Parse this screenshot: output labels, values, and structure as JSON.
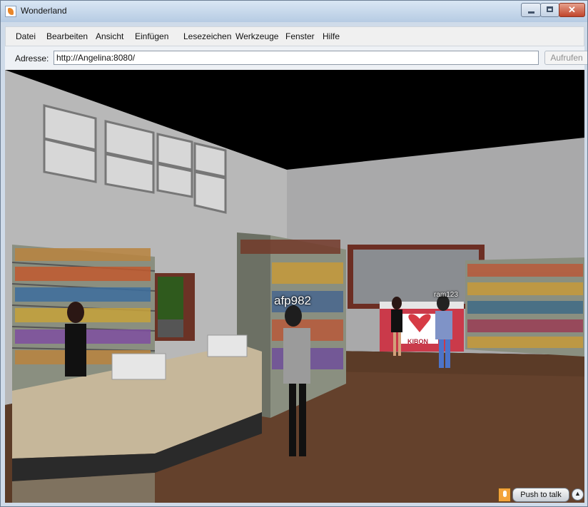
{
  "window": {
    "title": "Wonderland"
  },
  "menu": [
    "Datei",
    "Bearbeiten",
    "Ansicht",
    "Einfügen",
    "Lesezeichen",
    "Werkzeuge",
    "Fenster",
    "Hilfe"
  ],
  "address": {
    "label": "Adresse:",
    "value": "http://Angelina:8080/",
    "button": "Aufrufen"
  },
  "scene": {
    "avatars": [
      {
        "name": "afp982"
      },
      {
        "name": "ram123"
      }
    ],
    "sign_text": "KIBON"
  },
  "voice": {
    "push_to_talk": "Push to talk"
  }
}
